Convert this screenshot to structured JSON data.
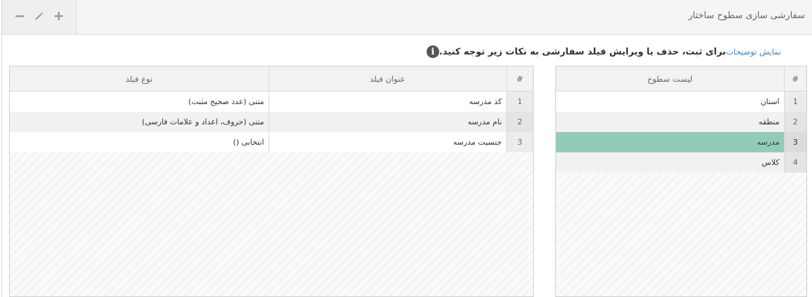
{
  "header": {
    "title": "سفارشی سازی سطوح ساختار",
    "tools": {
      "add": "add",
      "edit": "edit",
      "remove": "remove"
    }
  },
  "info": {
    "text": "برای ثبت، حذف یا ویرایش فیلد سفارشی به نکات زیر توجه کنید.",
    "link": "نمایش توضیحات",
    "icon_char": "i"
  },
  "levels": {
    "headers": {
      "num": "#",
      "name": "لیست سطوح"
    },
    "rows": [
      {
        "num": "1",
        "name": "استان"
      },
      {
        "num": "2",
        "name": "منطقه"
      },
      {
        "num": "3",
        "name": "مدرسه"
      },
      {
        "num": "4",
        "name": "کلاس"
      }
    ],
    "selected_color": "#93cbb9"
  },
  "fields": {
    "headers": {
      "num": "#",
      "title": "عنوان فیلد",
      "type": "نوع فیلد"
    },
    "rows": [
      {
        "num": "1",
        "title": "کد مدرسه",
        "type": "متنی (عدد صحیح مثبت)"
      },
      {
        "num": "2",
        "title": "نام مدرسه",
        "type": "متنی (حروف، اعداد و علامات فارسی)"
      },
      {
        "num": "3",
        "title": "جنسیت مدرسه",
        "type": "انتخابی ()"
      }
    ]
  }
}
